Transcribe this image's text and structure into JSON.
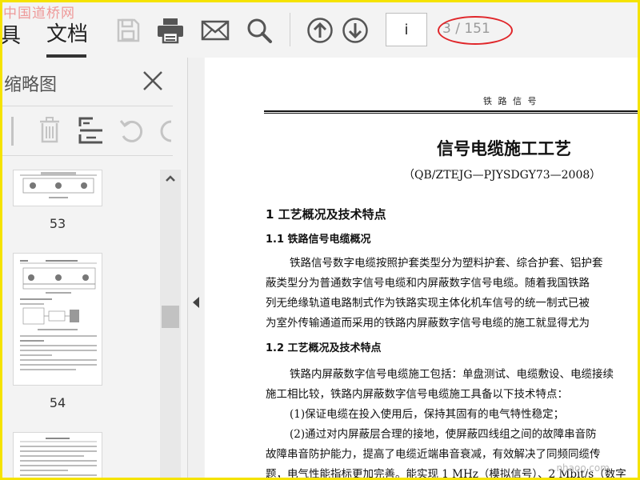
{
  "watermark": "中国道桥网",
  "watermark_bottom": "...nhaoo.com",
  "toolbar": {
    "tools_label": "具",
    "doc_label": "文档",
    "page_input_value": "i",
    "page_count": "3 / 151"
  },
  "sidebar": {
    "title": "缩略图",
    "thumbnails": [
      {
        "label": "53"
      },
      {
        "label": "54"
      },
      {
        "label": ""
      }
    ]
  },
  "document": {
    "running_head": "铁 路 信 号",
    "title": "信号电缆施工工艺",
    "subtitle": "（QB/ZTEJG—PJYSDGY73—2008）",
    "section1": "1   工艺概况及技术特点",
    "section1_1": "1.1   铁路信号电缆概况",
    "para1": [
      "铁路信号数字电缆按照护套类型分为塑料护套、综合护套、铝护套",
      "蔽类型分为普通数字信号电缆和内屏蔽数字信号电缆。随着我国铁路",
      "列无绝缘轨道电路制式作为铁路实现主体化机车信号的统一制式已被",
      "为室外传输通道而采用的铁路内屏蔽数字信号电缆的施工就显得尤为"
    ],
    "section1_2": "1.2   工艺概况及技术特点",
    "para2": [
      "铁路内屏蔽数字信号电缆施工包括：单盘测试、电缆敷设、电缆接续",
      "施工相比较，铁路内屏蔽数字信号电缆施工具备以下技术特点：",
      "(1)保证电缆在投入使用后，保持其固有的电气特性稳定；",
      "(2)通过对内屏蔽层合理的接地，使屏蔽四线组之间的故障串音防",
      "故障串音防护能力，提高了电缆近端串音衰减，有效解决了同频同缆传",
      "题，电气性能指标更加完善。能实现 1 MHz（模拟信号）、2 Mbit/s（数字"
    ]
  },
  "colors": {
    "highlight_ellipse": "#e0262a",
    "frame": "#f5e300",
    "icon_gray": "#555555",
    "icon_disabled": "#c4c4c4"
  }
}
